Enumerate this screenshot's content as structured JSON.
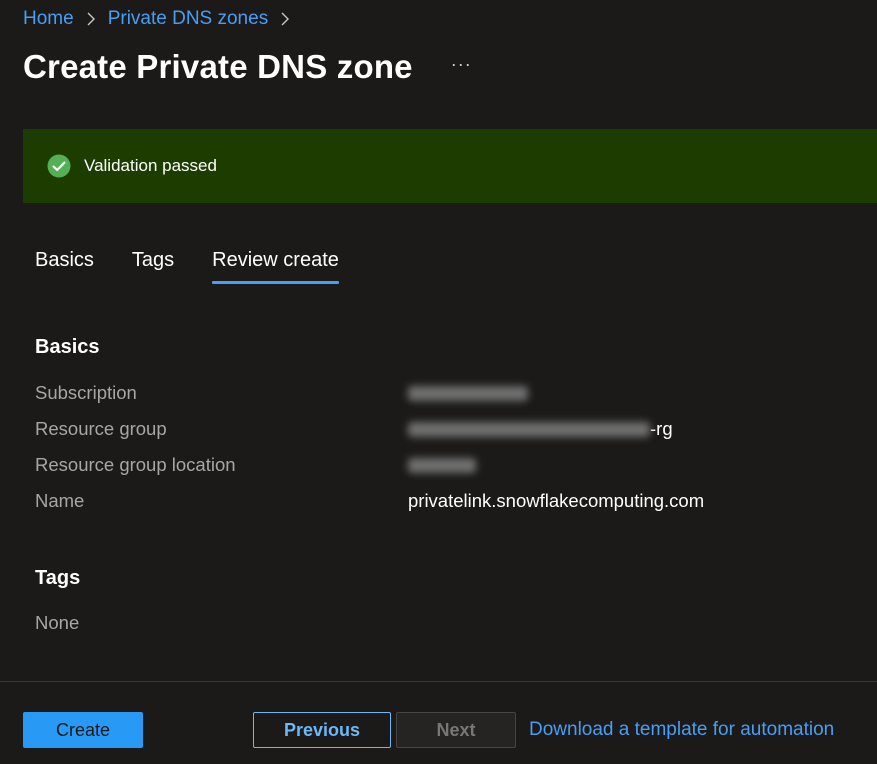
{
  "breadcrumb": {
    "items": [
      "Home",
      "Private DNS zones"
    ]
  },
  "header": {
    "title": "Create Private DNS zone",
    "more": "···"
  },
  "banner": {
    "text": "Validation passed",
    "color": "#1d3d00",
    "icon": "check-circle-icon"
  },
  "tabs": [
    {
      "label": "Basics",
      "active": false
    },
    {
      "label": "Tags",
      "active": false
    },
    {
      "label": "Review create",
      "active": true
    }
  ],
  "basics": {
    "heading": "Basics",
    "rows": [
      {
        "key": "Subscription",
        "value": ""
      },
      {
        "key": "Resource group",
        "value": "-rg"
      },
      {
        "key": "Resource group location",
        "value": ""
      },
      {
        "key": "Name",
        "value": "privatelink.snowflakecomputing.com"
      }
    ]
  },
  "tags": {
    "heading": "Tags",
    "value": "None"
  },
  "footer": {
    "create": "Create",
    "previous": "Previous",
    "next": "Next",
    "download": "Download a template for automation"
  },
  "colors": {
    "accent": "#479ef5",
    "primary_button": "#2899f5",
    "success": "#54b054"
  }
}
